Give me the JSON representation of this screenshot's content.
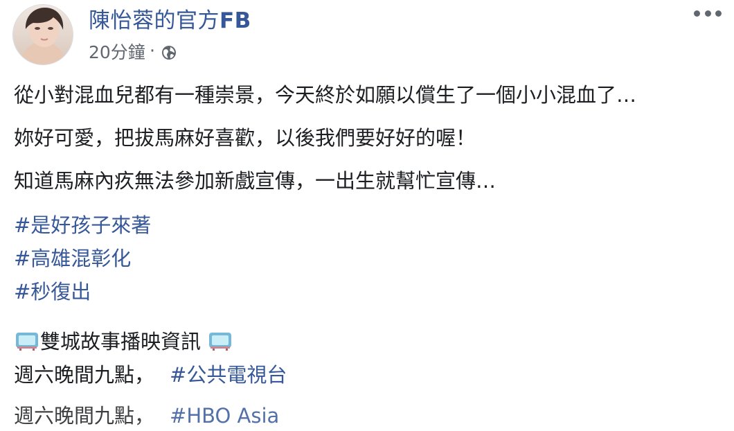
{
  "post": {
    "author_name": "陳怡蓉的官方",
    "author_suffix": "FB",
    "timestamp": "20分鐘",
    "separator": "·",
    "privacy_icon": "globe-icon",
    "more_icon": "more-options-icon",
    "paragraphs": [
      "從小對混血兒都有一種崇景，今天終於如願以償生了一個小小混血了…",
      "妳好可愛，把拔馬麻好喜歡，以後我們要好好的喔！",
      "知道馬麻內疚無法參加新戲宣傳，一出生就幫忙宣傳…"
    ],
    "hashtags": [
      "#是好孩子來著",
      "#高雄混彰化",
      "#秒復出"
    ],
    "broadcast": {
      "emoji_name": "tv-icon",
      "title": "雙城故事播映資訊",
      "line1_text": "週六晚間九點，",
      "line1_tag": "#公共電視台",
      "line2_text": "週六晚間九點，",
      "line2_tag": "#HBO Asia"
    }
  }
}
